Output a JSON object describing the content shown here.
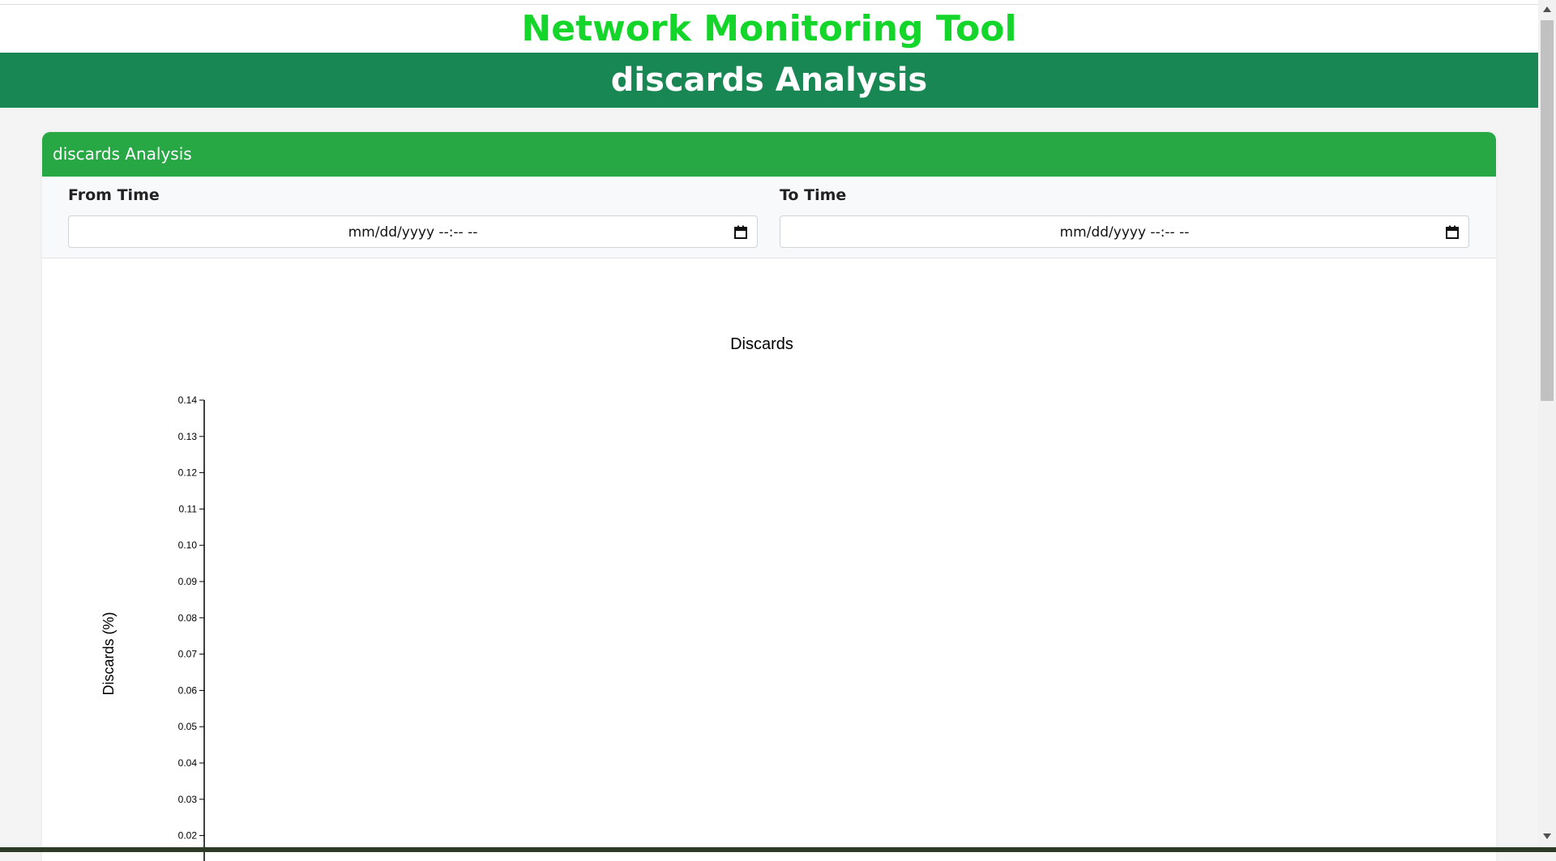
{
  "app": {
    "title": "Network Monitoring Tool"
  },
  "page": {
    "banner": "discards Analysis"
  },
  "card": {
    "header": "discards Analysis",
    "from": {
      "label": "From Time",
      "placeholder": "mm/dd/yyyy --:-- --"
    },
    "to": {
      "label": "To Time",
      "placeholder": "mm/dd/yyyy --:-- --"
    }
  },
  "colors": {
    "title": "#14d62a",
    "banner": "#198754",
    "card_header": "#28a745"
  },
  "chart_data": {
    "type": "line",
    "title": "Discards",
    "ylabel": "Discards (%)",
    "xlabel": "",
    "ylim": [
      0.02,
      0.14
    ],
    "yticks": [
      "0.14",
      "0.13",
      "0.12",
      "0.11",
      "0.10",
      "0.09",
      "0.08",
      "0.07",
      "0.06",
      "0.05",
      "0.04",
      "0.03",
      "0.02"
    ],
    "series": []
  }
}
